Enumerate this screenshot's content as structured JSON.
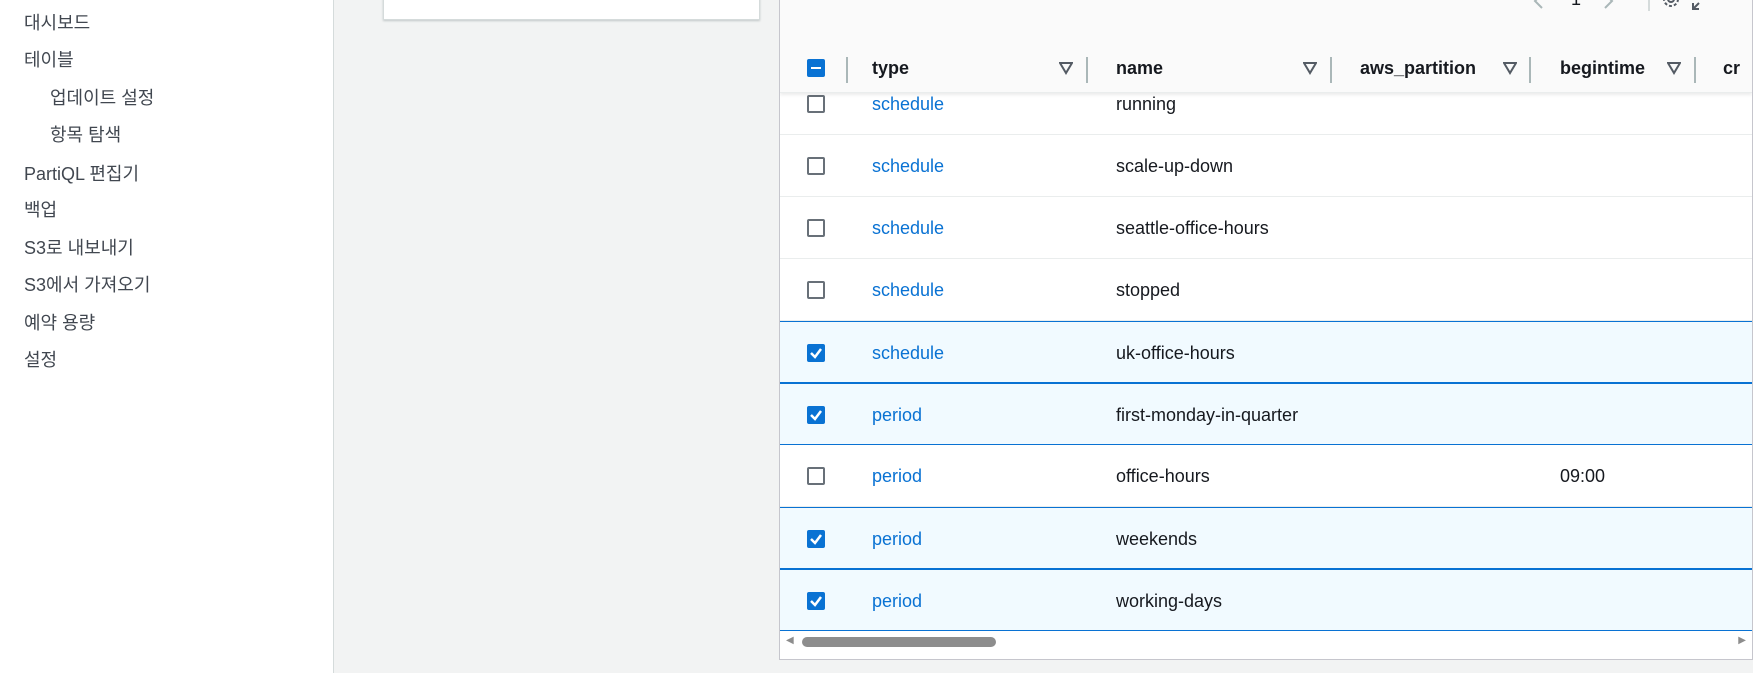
{
  "sidebar": {
    "items": [
      {
        "label": "대시보드",
        "sub": false
      },
      {
        "label": "테이블",
        "sub": false
      },
      {
        "label": "업데이트 설정",
        "sub": true
      },
      {
        "label": "항목 탐색",
        "sub": true
      },
      {
        "label": "PartiQL 편집기",
        "sub": false
      },
      {
        "label": "백업",
        "sub": false
      },
      {
        "label": "S3로 내보내기",
        "sub": false
      },
      {
        "label": "S3에서 가져오기",
        "sub": false
      },
      {
        "label": "예약 용량",
        "sub": false
      },
      {
        "label": "설정",
        "sub": false
      }
    ]
  },
  "table": {
    "pagination": {
      "current_page": "1"
    },
    "columns": [
      {
        "label": "type"
      },
      {
        "label": "name"
      },
      {
        "label": "aws_partition"
      },
      {
        "label": "begintime"
      },
      {
        "label": "cr"
      }
    ],
    "rows": [
      {
        "type": "schedule",
        "name": "running",
        "aws_partition": "",
        "begintime": "",
        "selected": false
      },
      {
        "type": "schedule",
        "name": "scale-up-down",
        "aws_partition": "",
        "begintime": "",
        "selected": false
      },
      {
        "type": "schedule",
        "name": "seattle-office-hours",
        "aws_partition": "",
        "begintime": "",
        "selected": false
      },
      {
        "type": "schedule",
        "name": "stopped",
        "aws_partition": "",
        "begintime": "",
        "selected": false
      },
      {
        "type": "schedule",
        "name": "uk-office-hours",
        "aws_partition": "",
        "begintime": "",
        "selected": true
      },
      {
        "type": "period",
        "name": "first-monday-in-quarter",
        "aws_partition": "",
        "begintime": "",
        "selected": true
      },
      {
        "type": "period",
        "name": "office-hours",
        "aws_partition": "",
        "begintime": "09:00",
        "selected": false
      },
      {
        "type": "period",
        "name": "weekends",
        "aws_partition": "",
        "begintime": "",
        "selected": true
      },
      {
        "type": "period",
        "name": "working-days",
        "aws_partition": "",
        "begintime": "",
        "selected": true
      }
    ]
  },
  "icons": {
    "prev_page": "chevron-left-icon",
    "next_page": "chevron-right-icon",
    "settings": "gear-icon",
    "fullscreen": "expand-icon",
    "sort": "caret-down-icon"
  },
  "colors": {
    "link": "#0972d3",
    "selected_row_bg": "#f1faff",
    "selected_border": "#0972d3"
  }
}
